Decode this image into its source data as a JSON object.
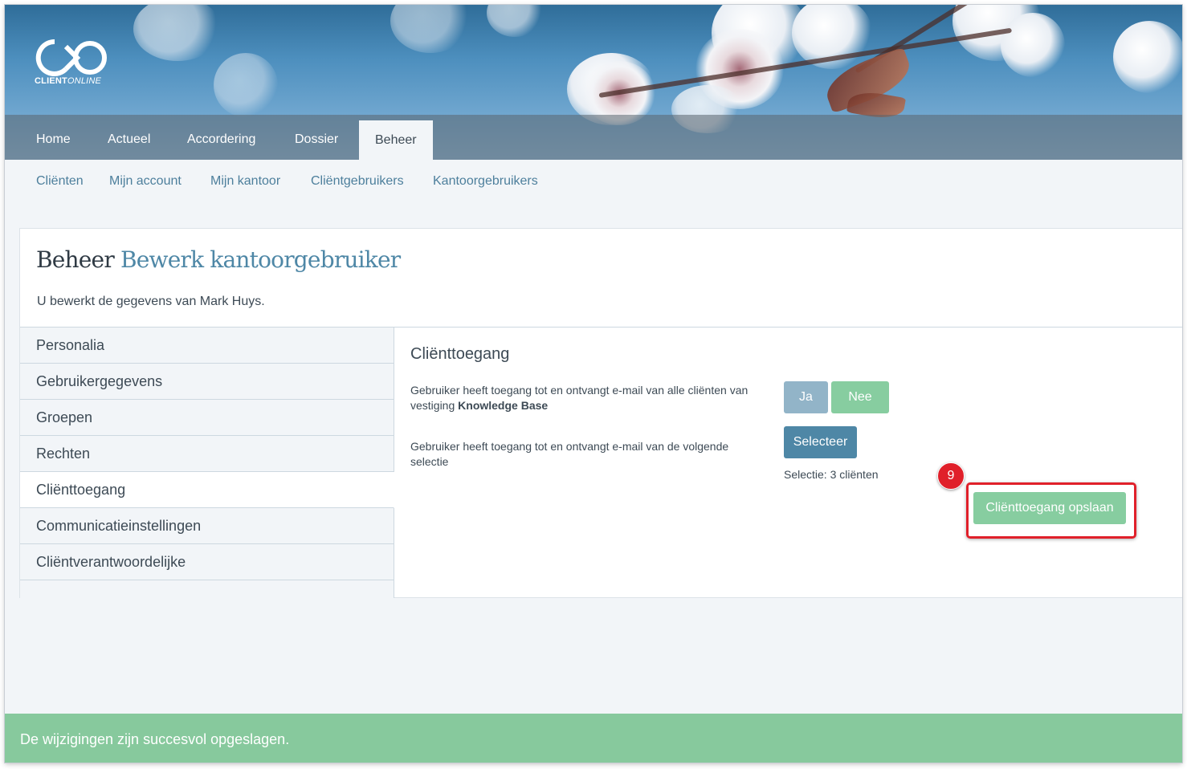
{
  "brand": {
    "name_strong": "CLIENT",
    "name_light": "ONLINE",
    "logo_icon": "infinity-logo-icon"
  },
  "main_nav": {
    "tabs": [
      {
        "label": "Home"
      },
      {
        "label": "Actueel"
      },
      {
        "label": "Accordering"
      },
      {
        "label": "Dossier"
      },
      {
        "label": "Beheer",
        "active": true
      }
    ]
  },
  "sub_nav": {
    "items": [
      {
        "label": "Cliënten"
      },
      {
        "label": "Mijn account"
      },
      {
        "label": "Mijn kantoor"
      },
      {
        "label": "Cliëntgebruikers"
      },
      {
        "label": "Kantoorgebruikers"
      }
    ]
  },
  "page": {
    "title_prefix": "Beheer",
    "title_accent": "Bewerk kantoorgebruiker",
    "intro": "U bewerkt de gegevens van Mark Huys."
  },
  "side_menu": {
    "items": [
      {
        "label": "Personalia"
      },
      {
        "label": "Gebruikergegevens"
      },
      {
        "label": "Groepen"
      },
      {
        "label": "Rechten"
      },
      {
        "label": "Cliënttoegang",
        "active": true
      },
      {
        "label": "Communicatieinstellingen"
      },
      {
        "label": "Cliëntverantwoordelijke"
      }
    ]
  },
  "panel": {
    "heading": "Cliënttoegang",
    "all_clients": {
      "text_before": "Gebruiker heeft toegang tot en ontvangt e-mail van alle cliënten van vestiging ",
      "text_bold": "Knowledge Base",
      "yes_label": "Ja",
      "no_label": "Nee"
    },
    "selection": {
      "text": "Gebruiker heeft toegang tot en ontvangt e-mail van de volgende selectie",
      "select_label": "Selecteer",
      "count_text": "Selectie: 3 cliënten"
    },
    "save_label": "Cliënttoegang opslaan",
    "step_badge": "9"
  },
  "status": {
    "message": "De wijzigingen zijn succesvol opgeslagen."
  },
  "colors": {
    "accent": "#4e87a6",
    "success": "#87cda0",
    "highlight": "#e0202a"
  }
}
